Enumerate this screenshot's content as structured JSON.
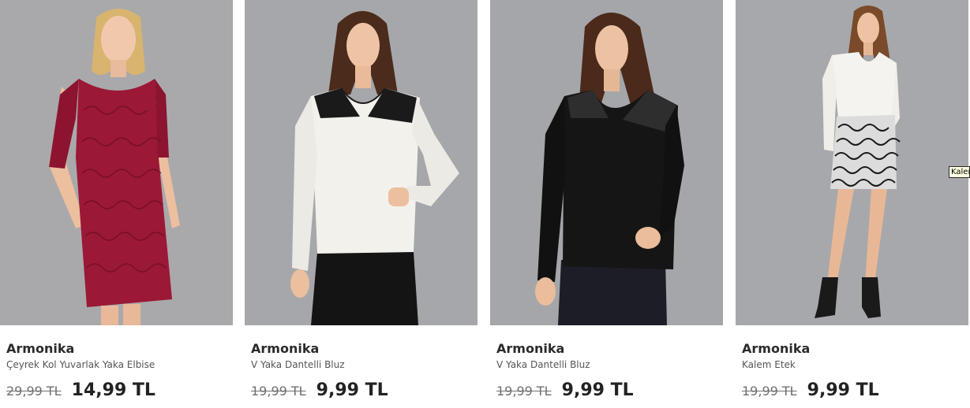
{
  "products": [
    {
      "brand": "Armonika",
      "name": "Çeyrek Kol Yuvarlak Yaka Elbise",
      "old_price": "29,99 TL",
      "new_price": "14,99 TL",
      "image_alt": "red-lace-dress-photo"
    },
    {
      "brand": "Armonika",
      "name": "V Yaka Dantelli Bluz",
      "old_price": "19,99 TL",
      "new_price": "9,99 TL",
      "image_alt": "white-lace-blouse-photo"
    },
    {
      "brand": "Armonika",
      "name": "V Yaka Dantelli Bluz",
      "old_price": "19,99 TL",
      "new_price": "9,99 TL",
      "image_alt": "black-lace-blouse-photo"
    },
    {
      "brand": "Armonika",
      "name": "Kalem Etek",
      "old_price": "19,99 TL",
      "new_price": "9,99 TL",
      "image_alt": "pencil-skirt-photo"
    }
  ],
  "tooltip": {
    "text": "Kalem Etek"
  },
  "colors": {
    "photo_background": "#a6a6a8",
    "dress_red": "#9b1836",
    "blouse_white": "#f3f1ec",
    "blouse_black": "#151515"
  }
}
